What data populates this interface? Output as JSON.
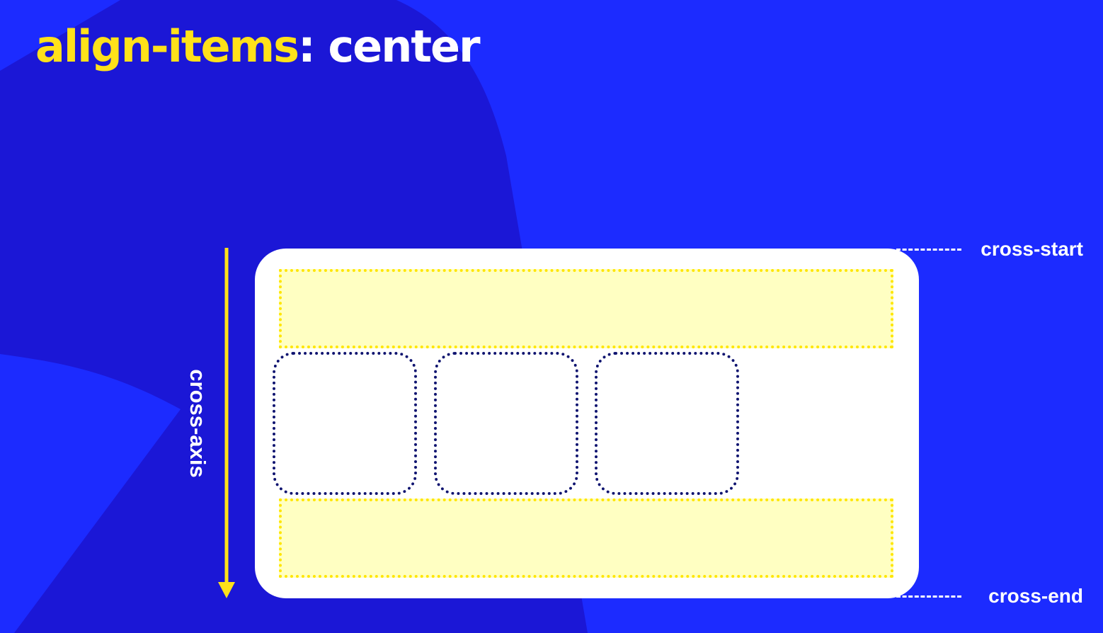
{
  "title": {
    "keyword": "align-items",
    "value": ": center"
  },
  "axis": {
    "label": "cross-axis"
  },
  "markers": {
    "start": "cross-start",
    "end": "cross-end"
  },
  "items": [
    {
      "id": "item-1"
    },
    {
      "id": "item-2"
    },
    {
      "id": "item-3"
    }
  ],
  "colors": {
    "background": "#1c2bff",
    "blob": "#1b17d6",
    "accent_yellow": "#ffe11a",
    "line_fill": "#ffffc2",
    "item_border": "#0f1470"
  }
}
